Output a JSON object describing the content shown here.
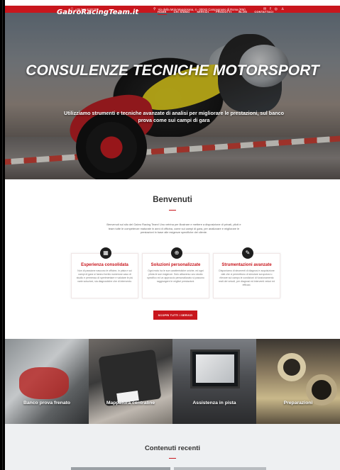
{
  "topbar": {
    "phone": "+39 339 6182307",
    "address": "Via della Mola Maggiorana, 4 - 00042 Campagnano di Roma (RM)",
    "social_icons": [
      "mail-icon",
      "facebook-icon",
      "instagram-icon",
      "user-icon"
    ],
    "colors": {
      "bar": "#c8161d"
    }
  },
  "nav": {
    "logo": "GabroRacingTeam.it",
    "items": [
      "HOME",
      "CHI SIAMO",
      "SERVIZI",
      "PRODOTTI",
      "BLOG",
      "CONTATTACI"
    ]
  },
  "hero": {
    "title": "CONSULENZE TECNICHE MOTORSPORT",
    "subtitle": "Utilizziamo strumenti e tecniche avanzate di analisi per migliorare le prestazioni, sul banco prova come sui campi di gara"
  },
  "welcome": {
    "title": "Benvenuti",
    "text": "Benvenuti sul sito del Gabro Racing Team! Uno vetrina per illustrare e mettere a disposizione di privati, piloti e team tutte le competenze maturate in anni di officina, come sui campi di gara, per analizzare e migliorare le prestazioni in base alle esigenze specifiche del cliente."
  },
  "features": [
    {
      "icon": "garage-icon",
      "title": "Esperienza consolidata",
      "text": "Non di passione nascono le officine, in pista e sui campi di gara si hanno fornito numerose caso di studio e permesso di sperimentare e valutare le più varie soluzioni, sia diagnostiche che di intervento."
    },
    {
      "icon": "target-icon",
      "title": "Soluzioni personalizzate",
      "text": "Ogni moto ha le sue caratteristiche uniche, ed ogni pilota le sue esigenze. Solo attraverso uno studio specifico ed un approccio personalizzato si possono raggiungere le migliori prestazioni."
    },
    {
      "icon": "wrench-icon",
      "title": "Strumentazioni avanzate",
      "text": "Disponiamo di strumenti di diagnosi e acquisizione dati che ci permettono di simulare scrupolosi o rilevare sul campo le condizioni di funzionamento reali dei veicoli, per diagnosi ed interventi veloci ed efficaci."
    }
  ],
  "cta": "SCOPRI TUTTI I SERVIZI",
  "tiles": [
    "Banco prova frenato",
    "Mappatura centraline",
    "Assistenza in pista",
    "Preparazioni"
  ],
  "recent": {
    "title": "Contenuti recenti"
  }
}
